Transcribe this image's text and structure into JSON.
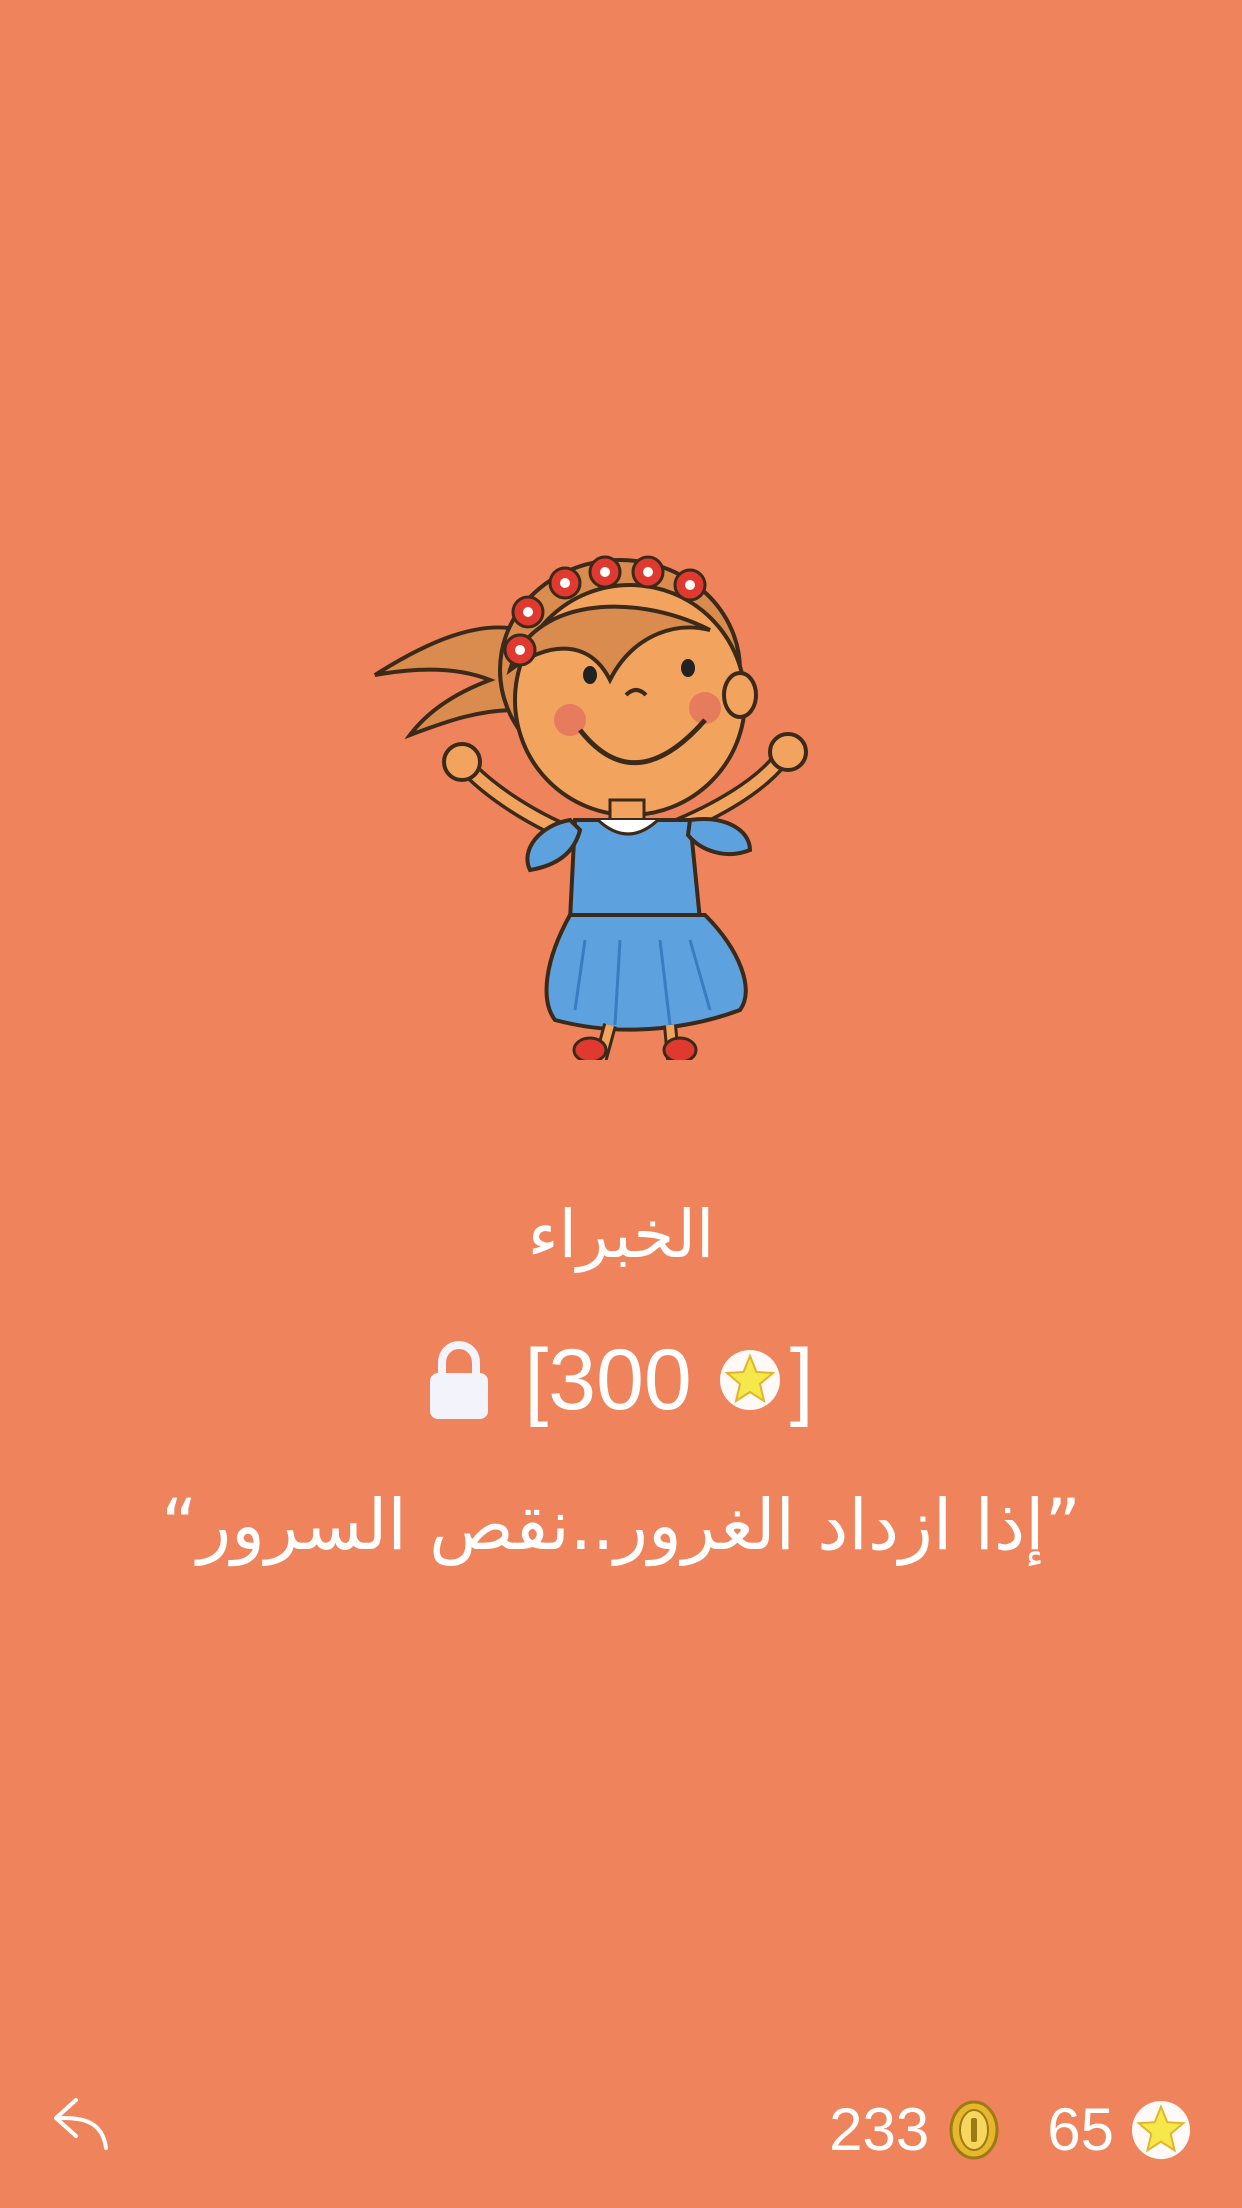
{
  "level": {
    "title": "الخبراء",
    "cost": "300",
    "cost_open": "[",
    "cost_close": "]",
    "quote": "”إذا ازداد الغرور..نقص السرور“",
    "locked": true
  },
  "stats": {
    "coins": "233",
    "stars": "65"
  },
  "icons": {
    "back": "back-arrow-icon",
    "lock": "lock-icon",
    "star": "star-icon",
    "coin": "coin-icon"
  },
  "colors": {
    "background": "#EF845C",
    "text": "#FFFFFF",
    "star": "#F6E84A",
    "coin": "#E6B62C"
  }
}
